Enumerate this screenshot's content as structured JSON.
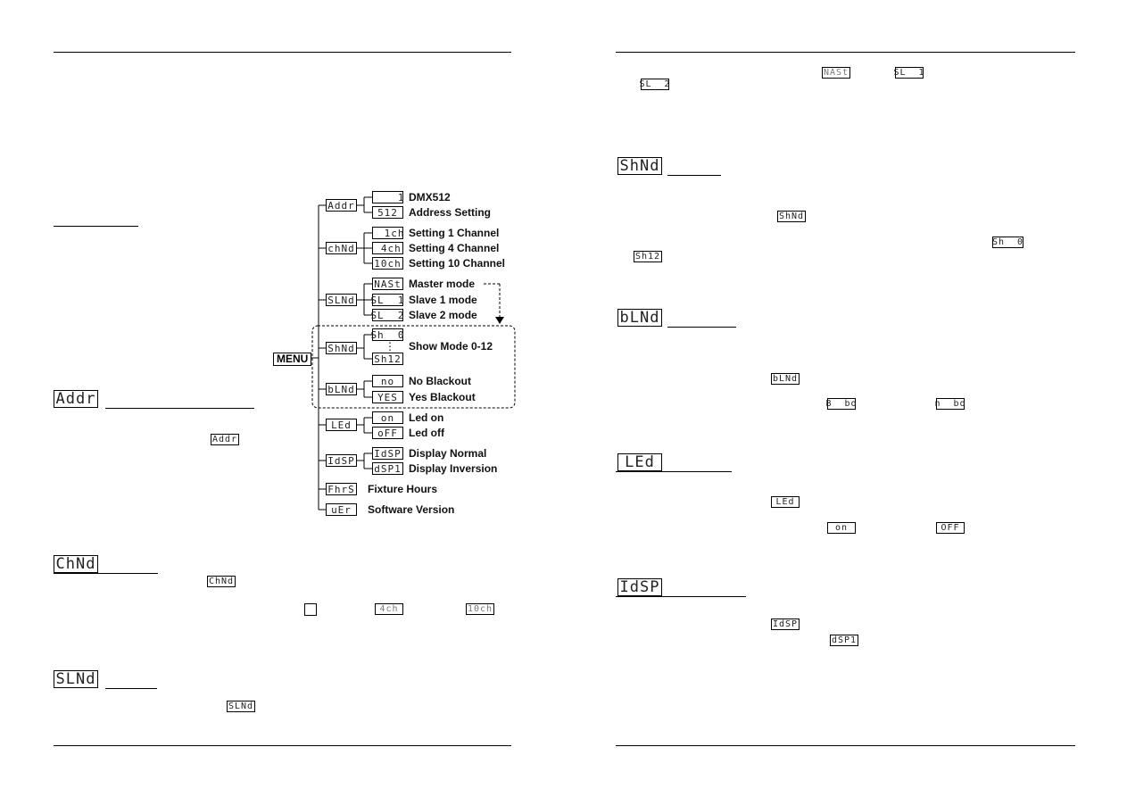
{
  "left_page": {
    "addr_section": {
      "heading_display": "Addr",
      "inline_display": "Addr"
    },
    "chnd_section": {
      "heading_display": "ChNd",
      "inline_display": "ChNd",
      "option_displays": [
        "4ch",
        "10ch"
      ]
    },
    "slnd_section": {
      "heading_display": "SLNd",
      "inline_display": "SLNd"
    },
    "menu_tree": {
      "root": "MENU",
      "branches": [
        {
          "code": "Addr",
          "children": [
            {
              "code": "    1",
              "label": "DMX512"
            },
            {
              "code": "512",
              "label": "Address Setting"
            }
          ]
        },
        {
          "code": "chNd",
          "children": [
            {
              "code": "  1ch",
              "label": "Setting 1 Channel"
            },
            {
              "code": " 4ch",
              "label": "Setting 4 Channel"
            },
            {
              "code": "10ch",
              "label": "Setting 10 Channel"
            }
          ]
        },
        {
          "code": "SLNd",
          "children": [
            {
              "code": "NASt",
              "label": "Master mode"
            },
            {
              "code": "SL  1",
              "label": "Slave 1 mode"
            },
            {
              "code": "SL  2",
              "label": "Slave 2 mode"
            }
          ]
        },
        {
          "code": "ShNd",
          "children": [
            {
              "code": "Sh  0",
              "label": "Show  Mode 0-12"
            },
            {
              "code": "Sh12",
              "label": ""
            }
          ]
        },
        {
          "code": "bLNd",
          "children": [
            {
              "code": "no",
              "label": "No Blackout"
            },
            {
              "code": "YES",
              "label": "Yes Blackout"
            }
          ]
        },
        {
          "code": "LEd",
          "children": [
            {
              "code": "on",
              "label": "Led on"
            },
            {
              "code": "oFF",
              "label": "Led off"
            }
          ]
        },
        {
          "code": "IdSP",
          "children": [
            {
              "code": "IdSP",
              "label": "Display Normal"
            },
            {
              "code": "dSP1",
              "label": "Display Inversion"
            }
          ]
        },
        {
          "code": "FhrS",
          "children": [],
          "label": "Fixture Hours"
        },
        {
          "code": "uEr",
          "children": [],
          "label": "Software Version"
        }
      ]
    }
  },
  "right_page": {
    "slave_displays": [
      "NASt",
      "SL  1",
      "SL  2"
    ],
    "shnd_section": {
      "heading_display": "ShNd",
      "inline_display": "ShNd",
      "range_displays": [
        "Sh  0",
        "Sh12"
      ]
    },
    "blnd_section": {
      "heading_display": "bLNd",
      "inline_display": "bLNd",
      "option_displays": [
        "B  bo",
        "n  bo"
      ]
    },
    "led_section": {
      "heading_display": "LEd",
      "inline_display": "LEd",
      "option_displays": [
        "on",
        "OFF"
      ]
    },
    "idsp_section": {
      "heading_display": "IdSP",
      "inline_display": "IdSP",
      "option_displays": [
        "dSP1"
      ]
    }
  }
}
